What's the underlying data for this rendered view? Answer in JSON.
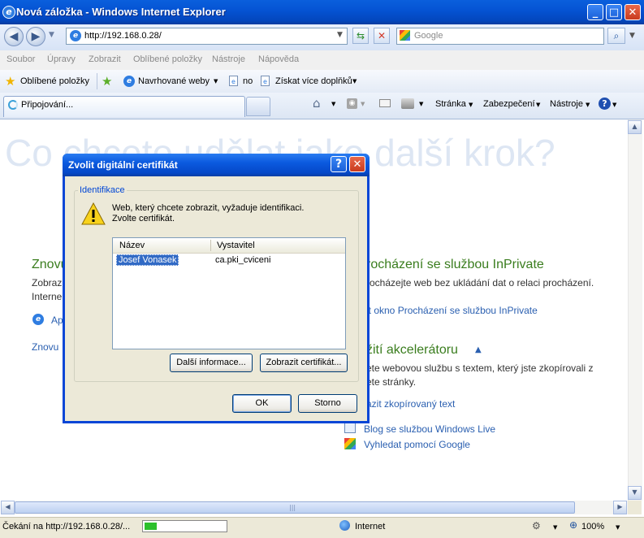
{
  "window": {
    "title": "Nová záložka - Windows Internet Explorer",
    "minimize": "_",
    "maximize": "□",
    "close": "✕"
  },
  "address": {
    "url": "http://192.168.0.28/",
    "search_placeholder": "Google"
  },
  "menu": [
    "Soubor",
    "Úpravy",
    "Zobrazit",
    "Oblíbené položky",
    "Nástroje",
    "Nápověda"
  ],
  "favorites": {
    "favorites_label": "Oblíbené položky",
    "suggested_sites": "Navrhované weby",
    "no_label": "no",
    "more_addons": "Získat více doplňků"
  },
  "tab": {
    "title": "Připojování..."
  },
  "commandbar": {
    "page": "Stránka",
    "security": "Zabezpečení",
    "tools": "Nástroje"
  },
  "page": {
    "heading": "Co chcete udělat jako další krok?",
    "left_heading": "Znovu",
    "left_text1": "Zobrazit",
    "left_text2": "Interne",
    "left_link1": "Ap",
    "left_link2": "Znovu",
    "inprivate_heading": "rocházení se službou InPrivate",
    "inprivate_text": "rocházejte web bez ukládání dat o relaci procházení.",
    "inprivate_link": "it okno Procházení se službou InPrivate",
    "accel_heading": "žití akcelerátoru",
    "accel_text1": "ete webovou službu s textem, který jste zkopírovali z",
    "accel_text2": "ete stránky.",
    "accel_link": "azit zkopírovaný text",
    "blog_link": "Blog se službou Windows Live",
    "google_link": "Vyhledat pomocí Google"
  },
  "dialog": {
    "title": "Zvolit digitální certifikát",
    "help": "?",
    "close": "✕",
    "group_label": "Identifikace",
    "message_line1": "Web, který chcete zobrazit, vyžaduje identifikaci.",
    "message_line2": "Zvolte certifikát.",
    "columns": [
      "Název",
      "Vystavitel"
    ],
    "rows": [
      {
        "name": "Josef Vonasek",
        "issuer": "ca.pki_cviceni"
      }
    ],
    "more_info_button": "Další informace...",
    "view_cert_button": "Zobrazit certifikát...",
    "ok_button": "OK",
    "cancel_button": "Storno"
  },
  "status": {
    "text": "Čekání na http://192.168.0.28/...",
    "progress_fraction": 0.15,
    "zone": "Internet",
    "zoom": "100%"
  },
  "colors": {
    "title_blue": "#0554d4",
    "link_blue": "#2a5fb0",
    "heading_green": "#3a7d1e",
    "dialog_bg": "#ece9d8"
  }
}
